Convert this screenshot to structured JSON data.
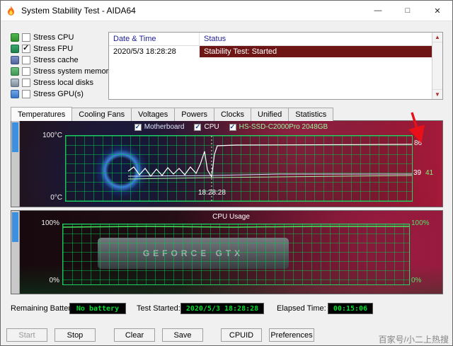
{
  "window": {
    "title": "System Stability Test - AIDA64",
    "controls": {
      "minimize": "—",
      "maximize": "□",
      "close": "✕"
    }
  },
  "stress_options": [
    {
      "label": "Stress CPU",
      "checked": false
    },
    {
      "label": "Stress FPU",
      "checked": true
    },
    {
      "label": "Stress cache",
      "checked": false
    },
    {
      "label": "Stress system memory",
      "checked": false
    },
    {
      "label": "Stress local disks",
      "checked": false
    },
    {
      "label": "Stress GPU(s)",
      "checked": false
    }
  ],
  "log": {
    "columns": [
      "Date & Time",
      "Status"
    ],
    "rows": [
      {
        "datetime": "2020/5/3 18:28:28",
        "status": "Stability Test: Started",
        "status_bg": "#6e1616"
      }
    ]
  },
  "tabs": [
    {
      "label": "Temperatures",
      "active": true
    },
    {
      "label": "Cooling Fans",
      "active": false
    },
    {
      "label": "Voltages",
      "active": false
    },
    {
      "label": "Powers",
      "active": false
    },
    {
      "label": "Clocks",
      "active": false
    },
    {
      "label": "Unified",
      "active": false
    },
    {
      "label": "Statistics",
      "active": false
    }
  ],
  "chart_data": [
    {
      "type": "line",
      "title": "Temperatures",
      "ylabel": "°C",
      "ylim": [
        0,
        100
      ],
      "axis_labels": {
        "top_left": "100°C",
        "bottom_left": "0°C"
      },
      "legend": [
        {
          "label": "Motherboard",
          "checked": true,
          "color": "#dfe6ff"
        },
        {
          "label": "CPU",
          "checked": true,
          "color": "#ffffff"
        },
        {
          "label": "HS-SSD-C2000Pro 2048GB",
          "checked": true,
          "color": "#9df79d"
        }
      ],
      "series": [
        {
          "name": "CPU",
          "current": 86
        },
        {
          "name": "Motherboard",
          "current": 41
        },
        {
          "name": "HS-SSD-C2000Pro 2048GB",
          "current": 39
        }
      ],
      "right_labels": [
        "86",
        "39",
        "41"
      ],
      "time_marker": "18:28:28",
      "grid": true,
      "annotation": "red-arrow-pointing-to-86"
    },
    {
      "type": "line",
      "title": "CPU Usage",
      "ylim": [
        0,
        100
      ],
      "left_labels": [
        "100%",
        "0%"
      ],
      "right_labels": [
        "100%",
        "0%"
      ],
      "series": [
        {
          "name": "CPU Usage",
          "current": 100
        }
      ],
      "grid": true
    }
  ],
  "photo_text": "GEFORCE GTX",
  "status_bar": {
    "battery_label": "Remaining Battery:",
    "battery_value": "No battery",
    "started_label": "Test Started:",
    "started_value": "2020/5/3 18:28:28",
    "elapsed_label": "Elapsed Time:",
    "elapsed_value": "00:15:06"
  },
  "buttons": [
    {
      "label": "Start",
      "enabled": false
    },
    {
      "label": "Stop",
      "enabled": true
    },
    {
      "label": "Clear",
      "enabled": true
    },
    {
      "label": "Save",
      "enabled": true
    },
    {
      "label": "CPUID",
      "enabled": true
    },
    {
      "label": "Preferences",
      "enabled": true
    }
  ],
  "watermark": "百家号/小二上热搜"
}
